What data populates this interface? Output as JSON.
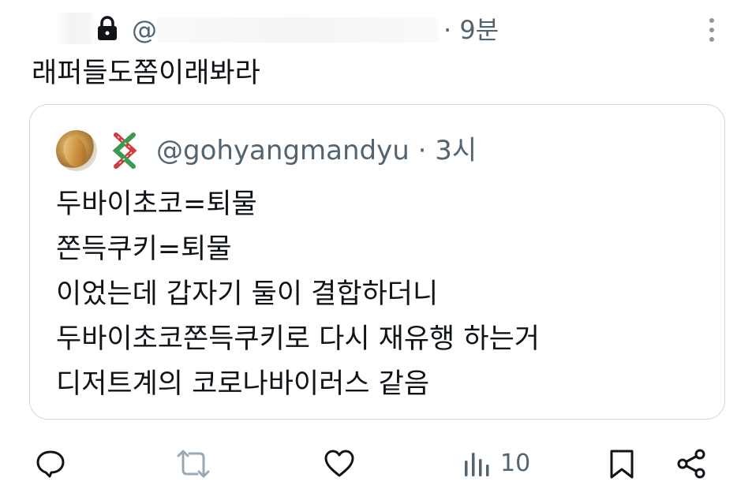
{
  "post": {
    "handle_prefix": "@",
    "time": "· 9분",
    "text": "래퍼들도쫌이래봐라"
  },
  "quote": {
    "handle": "@gohyangmandyu",
    "time": "· 3시",
    "lines": [
      "두바이초코=퇴물",
      "쫀득쿠키=퇴물",
      "이었는데 갑자기 둘이 결합하더니",
      "두바이초코쫀득쿠키로 다시 재유행 하는거",
      "디저트계의 코로나바이러스 같음"
    ]
  },
  "actions": {
    "views_count": "10",
    "icons": [
      "reply-icon",
      "retweet-icon",
      "like-icon",
      "views-icon",
      "bookmark-icon",
      "share-icon"
    ]
  },
  "colors": {
    "text": "#0f1419",
    "secondary": "#536471",
    "border": "#cfd9de",
    "retweet_disabled": "#9aa8b3"
  }
}
